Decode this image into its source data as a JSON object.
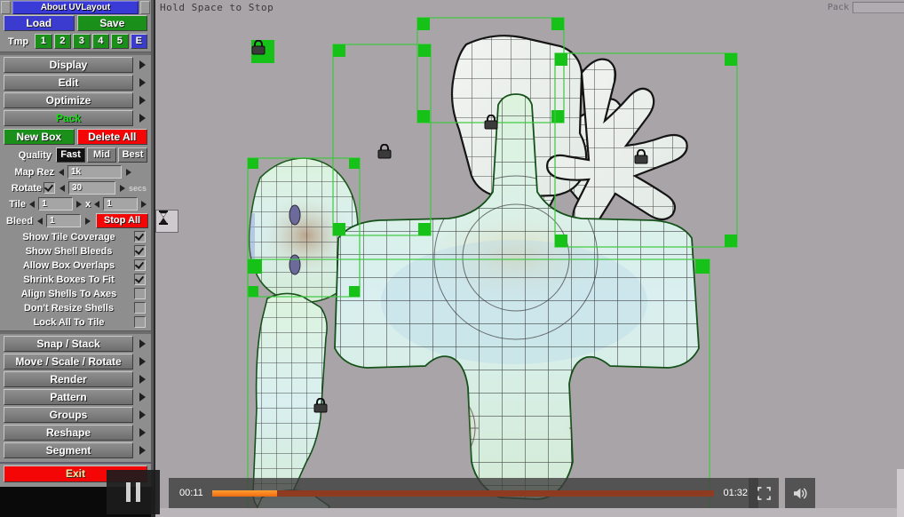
{
  "app": {
    "title": "About UVLayout"
  },
  "sidebar": {
    "file": {
      "load": "Load",
      "save": "Save"
    },
    "tmp": {
      "label": "Tmp",
      "slots": [
        "1",
        "2",
        "3",
        "4",
        "5"
      ],
      "extra": "E"
    },
    "menus": [
      {
        "label": "Display",
        "active": false
      },
      {
        "label": "Edit",
        "active": false
      },
      {
        "label": "Optimize",
        "active": false
      },
      {
        "label": "Pack",
        "active": true
      }
    ],
    "box": {
      "new": "New Box",
      "delete": "Delete All"
    },
    "quality": {
      "label": "Quality",
      "options": [
        "Fast",
        "Mid",
        "Best"
      ],
      "selected": "Fast"
    },
    "map_rez": {
      "label": "Map Rez",
      "value": "1k"
    },
    "rotate": {
      "label": "Rotate",
      "checked": true,
      "value": "30",
      "units": "secs"
    },
    "tile": {
      "label": "Tile",
      "x_value": "1",
      "y_value": "1",
      "sep": "x"
    },
    "bleed": {
      "label": "Bleed",
      "value": "1",
      "stop": "Stop All"
    },
    "toggles": [
      {
        "label": "Show Tile Coverage",
        "checked": true
      },
      {
        "label": "Show Shell Bleeds",
        "checked": true
      },
      {
        "label": "Allow Box Overlaps",
        "checked": true
      },
      {
        "label": "Shrink Boxes To Fit",
        "checked": true
      },
      {
        "label": "Align Shells To Axes",
        "checked": false
      },
      {
        "label": "Don't Resize Shells",
        "checked": false
      },
      {
        "label": "Lock All To Tile",
        "checked": false
      }
    ],
    "tools": [
      {
        "label": "Snap / Stack"
      },
      {
        "label": "Move / Scale / Rotate"
      },
      {
        "label": "Render"
      },
      {
        "label": "Pattern"
      },
      {
        "label": "Groups"
      },
      {
        "label": "Reshape"
      },
      {
        "label": "Segment"
      }
    ],
    "exit": "Exit"
  },
  "canvas": {
    "hint": "Hold Space to Stop",
    "pack_label": "Pack",
    "background": "#a9a4a8",
    "selection_color": "#16c217"
  },
  "player": {
    "current_time": "00:11",
    "duration": "01:32",
    "progress_percent": 13,
    "state": "playing",
    "pause_icon": "pause-icon",
    "fullscreen_icon": "fullscreen-icon",
    "volume_icon": "volume-icon",
    "accent": "#ef6b12"
  }
}
